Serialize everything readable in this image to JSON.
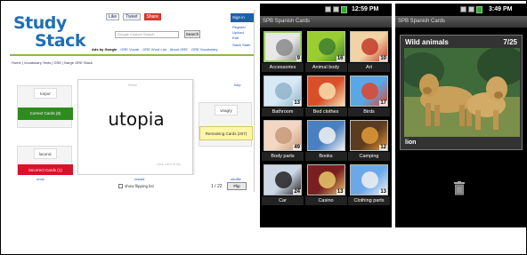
{
  "studystack": {
    "logo_top": "Study",
    "logo_bottom": "Stack",
    "social": [
      "Like",
      "Tweet",
      "Share"
    ],
    "search_placeholder": "Google Custom Search",
    "search_button": "Search",
    "links": [
      "Ads by Google",
      "GRE Vocab",
      "GRE Word List",
      "About GRE",
      "GRE Vocabulary"
    ],
    "login": "Sign in",
    "right_links": [
      "Register",
      "Upload",
      "Edit",
      "Stack Stats"
    ],
    "breadcrumb": "Home | Vocabulary Tests | GRE | Barge GRE Stack",
    "help": "help",
    "bins": {
      "left_top_word": "torpor",
      "left_top_button": "Correct Cards (8)",
      "left_bottom_word": "laconic",
      "left_bottom_button": "Incorrect Cards (1)",
      "right_word": "viragry",
      "right_button": "Remaining Cards (207)"
    },
    "card": {
      "word": "utopia",
      "tag": "Word",
      "foot": "click card to flip"
    },
    "bottom": {
      "left_link": "undo",
      "mid_link": "restart",
      "right_link": "shuffle",
      "shuffle_label": "show flipping list",
      "count": "1 / 22",
      "flip_button": "Flip"
    },
    "colors": {
      "correct": "#2e8b1e",
      "incorrect": "#d8122a",
      "remaining": "#fff6a8",
      "brand_blue": "#1f6fb4",
      "brand_green": "#7bb735"
    }
  },
  "phone_grid": {
    "time": "12:59 PM",
    "app_title": "SPB Spanish Cards",
    "tiles": [
      {
        "label": "Accessories",
        "count": "9",
        "icon": "watch-icon"
      },
      {
        "label": "Animal body",
        "count": "16",
        "icon": "tail-icon"
      },
      {
        "label": "Art",
        "count": "10",
        "icon": "paintbrush-icon"
      },
      {
        "label": "Bathroom",
        "count": "13",
        "icon": "faucet-icon"
      },
      {
        "label": "Bed clothes",
        "count": "",
        "icon": "shirt-icon"
      },
      {
        "label": "Birds",
        "count": "17",
        "icon": "parrot-icon"
      },
      {
        "label": "Body parts",
        "count": "49",
        "icon": "hand-icon"
      },
      {
        "label": "Books",
        "count": "",
        "icon": "books-icon"
      },
      {
        "label": "Camping",
        "count": "12",
        "icon": "tent-icon"
      },
      {
        "label": "Car",
        "count": "24",
        "icon": "car-icon"
      },
      {
        "label": "Casino",
        "count": "13",
        "icon": "casino-icon"
      },
      {
        "label": "Clothing parts",
        "count": "13",
        "icon": "fabric-icon"
      }
    ]
  },
  "phone_detail": {
    "time": "3:49 PM",
    "app_title": "SPB Spanish Cards",
    "card_title": "Wild animals",
    "card_count": "7/25",
    "word": "lion",
    "icon": "trash-icon"
  }
}
